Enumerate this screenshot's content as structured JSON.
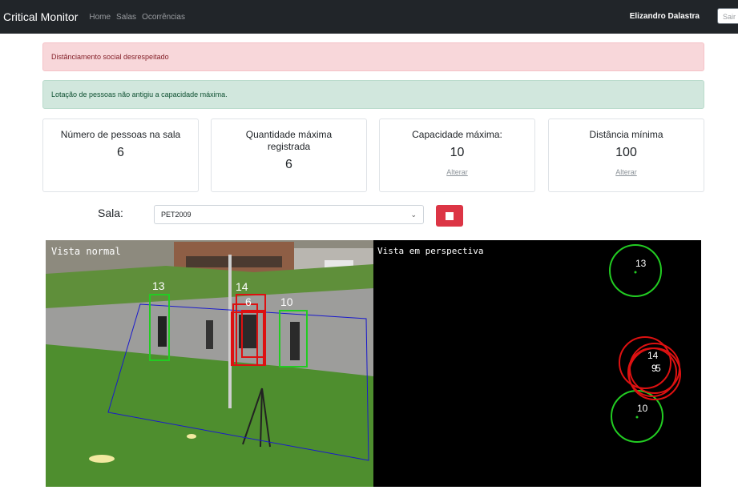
{
  "navbar": {
    "brand": "Critical Monitor",
    "links": [
      "Home",
      "Salas",
      "Ocorrências"
    ],
    "user": "Elizandro Dalastra",
    "logout": "Sair"
  },
  "alerts": {
    "danger": "Distânciamento social desrespeitado",
    "success": "Lotação de pessoas não antigiu a capacidade máxima."
  },
  "cards": [
    {
      "title": "Número de pessoas na sala",
      "value": "6"
    },
    {
      "title": "Quantidade máxima registrada",
      "value": "6"
    },
    {
      "title": "Capacidade máxima:",
      "value": "10",
      "link": "Alterar"
    },
    {
      "title": "Distância mínima",
      "value": "100",
      "link": "Alterar"
    }
  ],
  "sala": {
    "label": "Sala:",
    "selected": "PET2009"
  },
  "video": {
    "left_label": "Vista normal",
    "right_label": "Vista em perspectiva",
    "person_ids": [
      "13",
      "14",
      "10",
      "6",
      "9",
      "5"
    ],
    "colors": {
      "ok": "#22cc22",
      "violation": "#dd1111",
      "roi": "#1a1acc"
    }
  },
  "colors": {
    "navbar": "#212529",
    "danger_button": "#dc3545"
  }
}
